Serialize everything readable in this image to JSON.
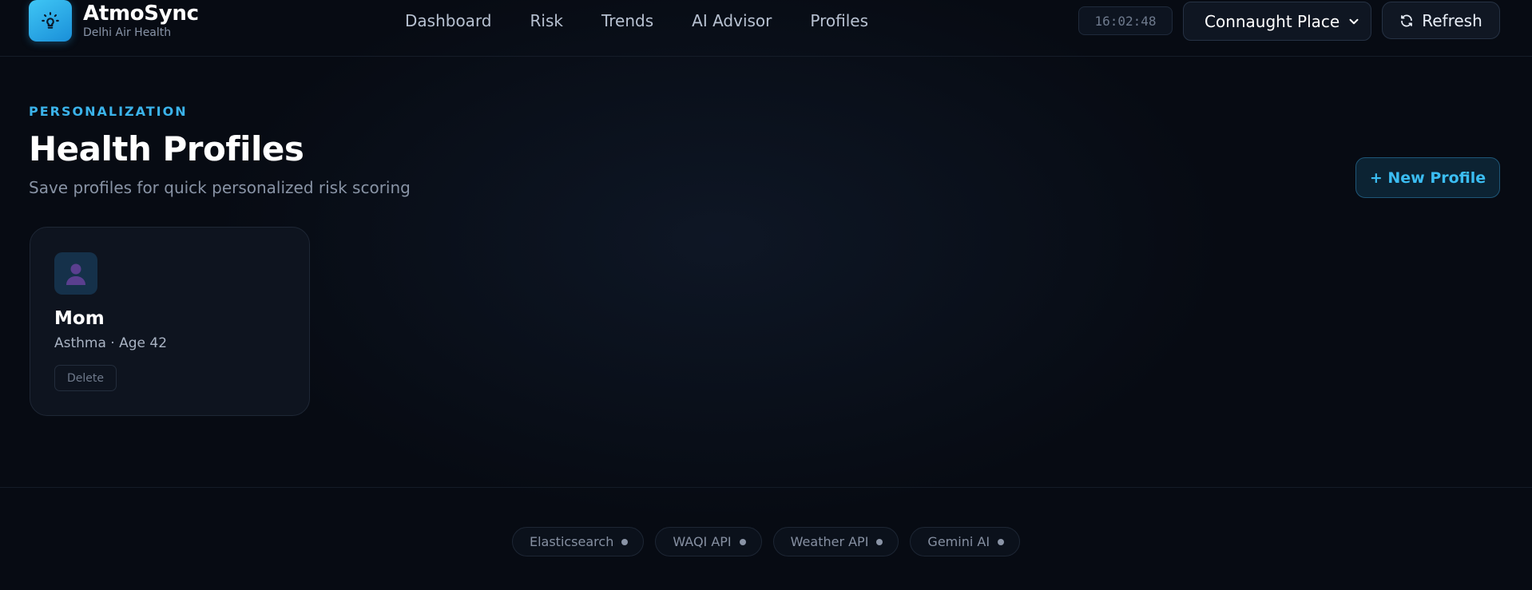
{
  "brand": {
    "title": "AtmoSync",
    "subtitle": "Delhi Air Health",
    "icon": "lightbulb-icon"
  },
  "nav": {
    "links": [
      "Dashboard",
      "Risk",
      "Trends",
      "AI Advisor",
      "Profiles"
    ]
  },
  "header_controls": {
    "clock": "16:02:48",
    "location_selected": "Connaught Place",
    "refresh_label": "Refresh",
    "refresh_icon": "refresh-icon"
  },
  "page": {
    "eyebrow": "PERSONALIZATION",
    "title": "Health Profiles",
    "subtitle": "Save profiles for quick personalized risk scoring",
    "new_profile_label": "+ New Profile"
  },
  "profiles": [
    {
      "name": "Mom",
      "detail": "Asthma · Age 42",
      "delete_label": "Delete",
      "avatar_icon": "person-icon"
    }
  ],
  "footer": {
    "services": [
      "Elasticsearch",
      "WAQI API",
      "Weather API",
      "Gemini AI"
    ]
  },
  "colors": {
    "background": "#070b13",
    "accent": "#3bb3ea",
    "card": "#0e141f"
  }
}
